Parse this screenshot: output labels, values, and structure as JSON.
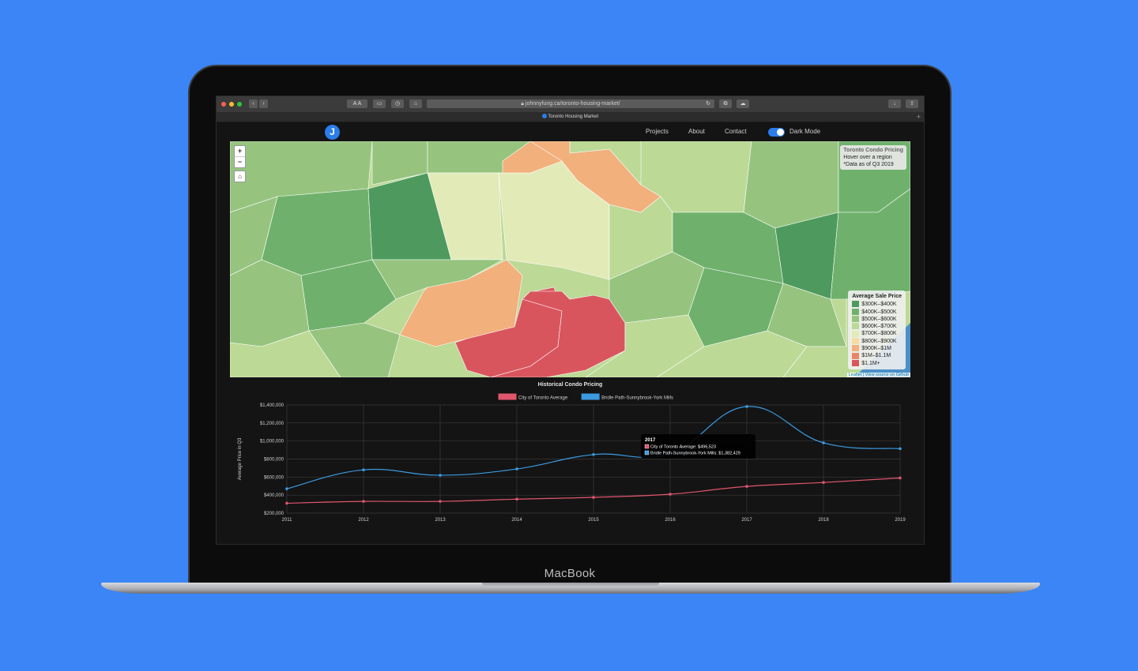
{
  "device": {
    "brand": "MacBook"
  },
  "browser": {
    "url": "johnnyfung.ca/toronto-housing-market/",
    "tab_title": "Toronto Housing Market",
    "reader_label": "A A"
  },
  "nav": {
    "logo": "J",
    "links": [
      "Projects",
      "About",
      "Contact"
    ],
    "dark_mode_label": "Dark Mode"
  },
  "map": {
    "zoom_in": "+",
    "zoom_out": "−",
    "info_title": "Toronto Condo Pricing",
    "info_hint": "Hover over a region",
    "info_note": "*Data as of Q3 2019",
    "legend_title": "Average Sale Price",
    "legend": [
      {
        "label": "$300K–$400K",
        "color": "#4e9a5e"
      },
      {
        "label": "$400K–$500K",
        "color": "#6fb16c"
      },
      {
        "label": "$500K–$600K",
        "color": "#96c47f"
      },
      {
        "label": "$600K–$700K",
        "color": "#bcd996"
      },
      {
        "label": "$700K–$800K",
        "color": "#e2eab8"
      },
      {
        "label": "$800K–$900K",
        "color": "#f5dca3"
      },
      {
        "label": "$900K–$1M",
        "color": "#f1b07c"
      },
      {
        "label": "$1M–$1.1M",
        "color": "#e88566"
      },
      {
        "label": "$1.1M+",
        "color": "#d9555e"
      }
    ],
    "attribution": "Leaflet | View source on Github"
  },
  "chart_data": {
    "type": "line",
    "title": "Historical Condo Pricing",
    "ylabel": "Average Price in Q3",
    "xlabel": "",
    "x": [
      "2011",
      "2012",
      "2013",
      "2014",
      "2015",
      "2016",
      "2017",
      "2018",
      "2019"
    ],
    "ylim": [
      200000,
      1400000
    ],
    "yticks": [
      "$200,000",
      "$400,000",
      "$600,000",
      "$800,000",
      "$1,000,000",
      "$1,200,000",
      "$1,400,000"
    ],
    "series": [
      {
        "name": "City of Toronto Average",
        "color": "#e0566d",
        "values": [
          310000,
          330000,
          330000,
          355000,
          375000,
          410000,
          496523,
          540000,
          590000
        ]
      },
      {
        "name": "Bridle Path-Sunnybrook-York Mills",
        "color": "#3b9ae0",
        "values": [
          470000,
          680000,
          620000,
          690000,
          850000,
          860000,
          1382429,
          980000,
          915000
        ]
      }
    ],
    "tooltip": {
      "title": "2017",
      "lines": [
        "City of Toronto Average: $496,523",
        "Bridle Path-Sunnybrook-York Mills: $1,382,429"
      ]
    }
  }
}
